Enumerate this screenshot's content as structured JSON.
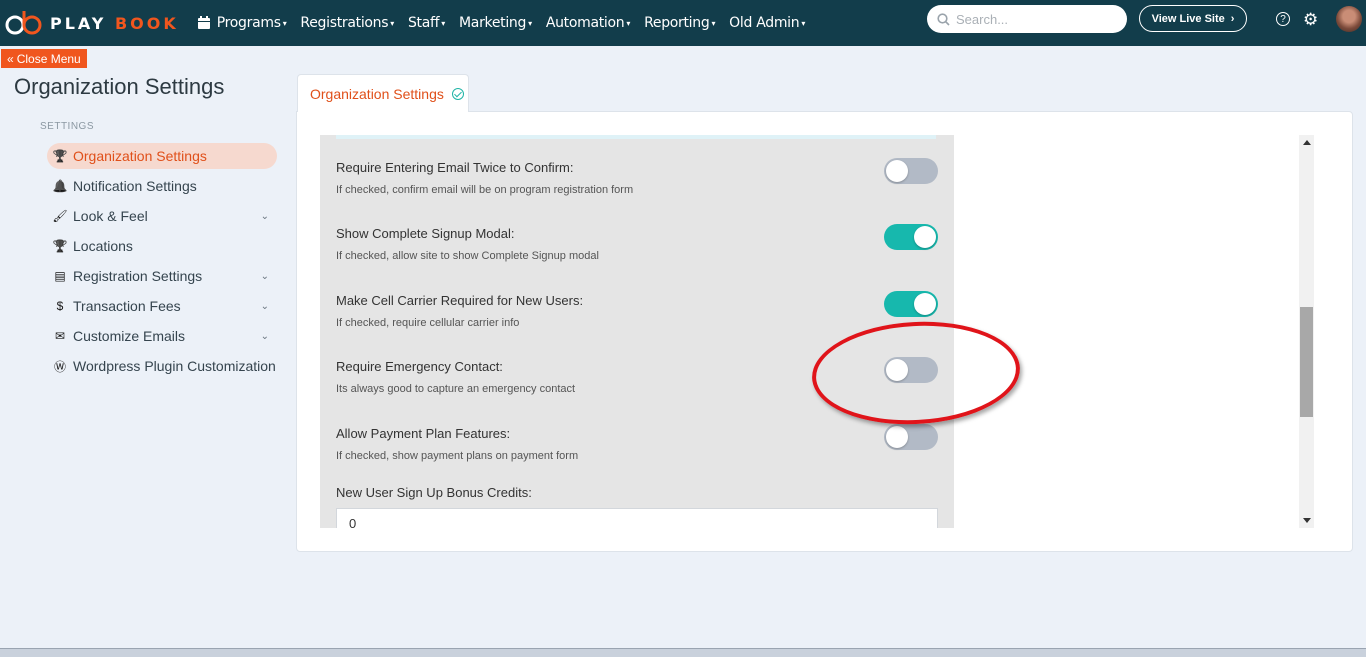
{
  "header": {
    "brand_play": "PLAY",
    "brand_book": "BOOK",
    "nav": [
      {
        "label": "Programs"
      },
      {
        "label": "Registrations"
      },
      {
        "label": "Staff"
      },
      {
        "label": "Marketing"
      },
      {
        "label": "Automation"
      },
      {
        "label": "Reporting"
      },
      {
        "label": "Old Admin"
      }
    ],
    "search_placeholder": "Search...",
    "live_site_label": "View Live Site",
    "help_label": "?"
  },
  "sidebar": {
    "close_menu_label": "Close Menu",
    "page_title": "Organization Settings",
    "section_label": "SETTINGS",
    "items": [
      {
        "label": "Organization Settings",
        "icon": "trophy-icon",
        "active": true
      },
      {
        "label": "Notification Settings",
        "icon": "bell-icon"
      },
      {
        "label": "Look & Feel",
        "icon": "paint-brush-icon",
        "expandable": true
      },
      {
        "label": "Locations",
        "icon": "trophy-icon"
      },
      {
        "label": "Registration Settings",
        "icon": "form-icon",
        "expandable": true
      },
      {
        "label": "Transaction Fees",
        "icon": "dollar-icon",
        "expandable": true
      },
      {
        "label": "Customize Emails",
        "icon": "envelope-icon",
        "expandable": true
      },
      {
        "label": "Wordpress Plugin Customization",
        "icon": "wordpress-icon"
      }
    ]
  },
  "main": {
    "tab_label": "Organization Settings",
    "settings": [
      {
        "title": "Require Entering Email Twice to Confirm:",
        "desc": "If checked, confirm email will be on program registration form",
        "on": false
      },
      {
        "title": "Show Complete Signup Modal:",
        "desc": "If checked, allow site to show Complete Signup modal",
        "on": true
      },
      {
        "title": "Make Cell Carrier Required for New Users:",
        "desc": "If checked, require cellular carrier info",
        "on": true
      },
      {
        "title": "Require Emergency Contact:",
        "desc": "Its always good to capture an emergency contact",
        "on": false
      },
      {
        "title": "Allow Payment Plan Features:",
        "desc": "If checked, show payment plans on payment form",
        "on": false
      }
    ],
    "bonus_title": "New User Sign Up Bonus Credits:",
    "bonus_value": "0"
  },
  "colors": {
    "nav_bg": "#123d4b",
    "accent": "#f0561e",
    "toggle_on": "#17b8ad",
    "toggle_off": "#b2bac6",
    "annotation": "#e0141a"
  }
}
